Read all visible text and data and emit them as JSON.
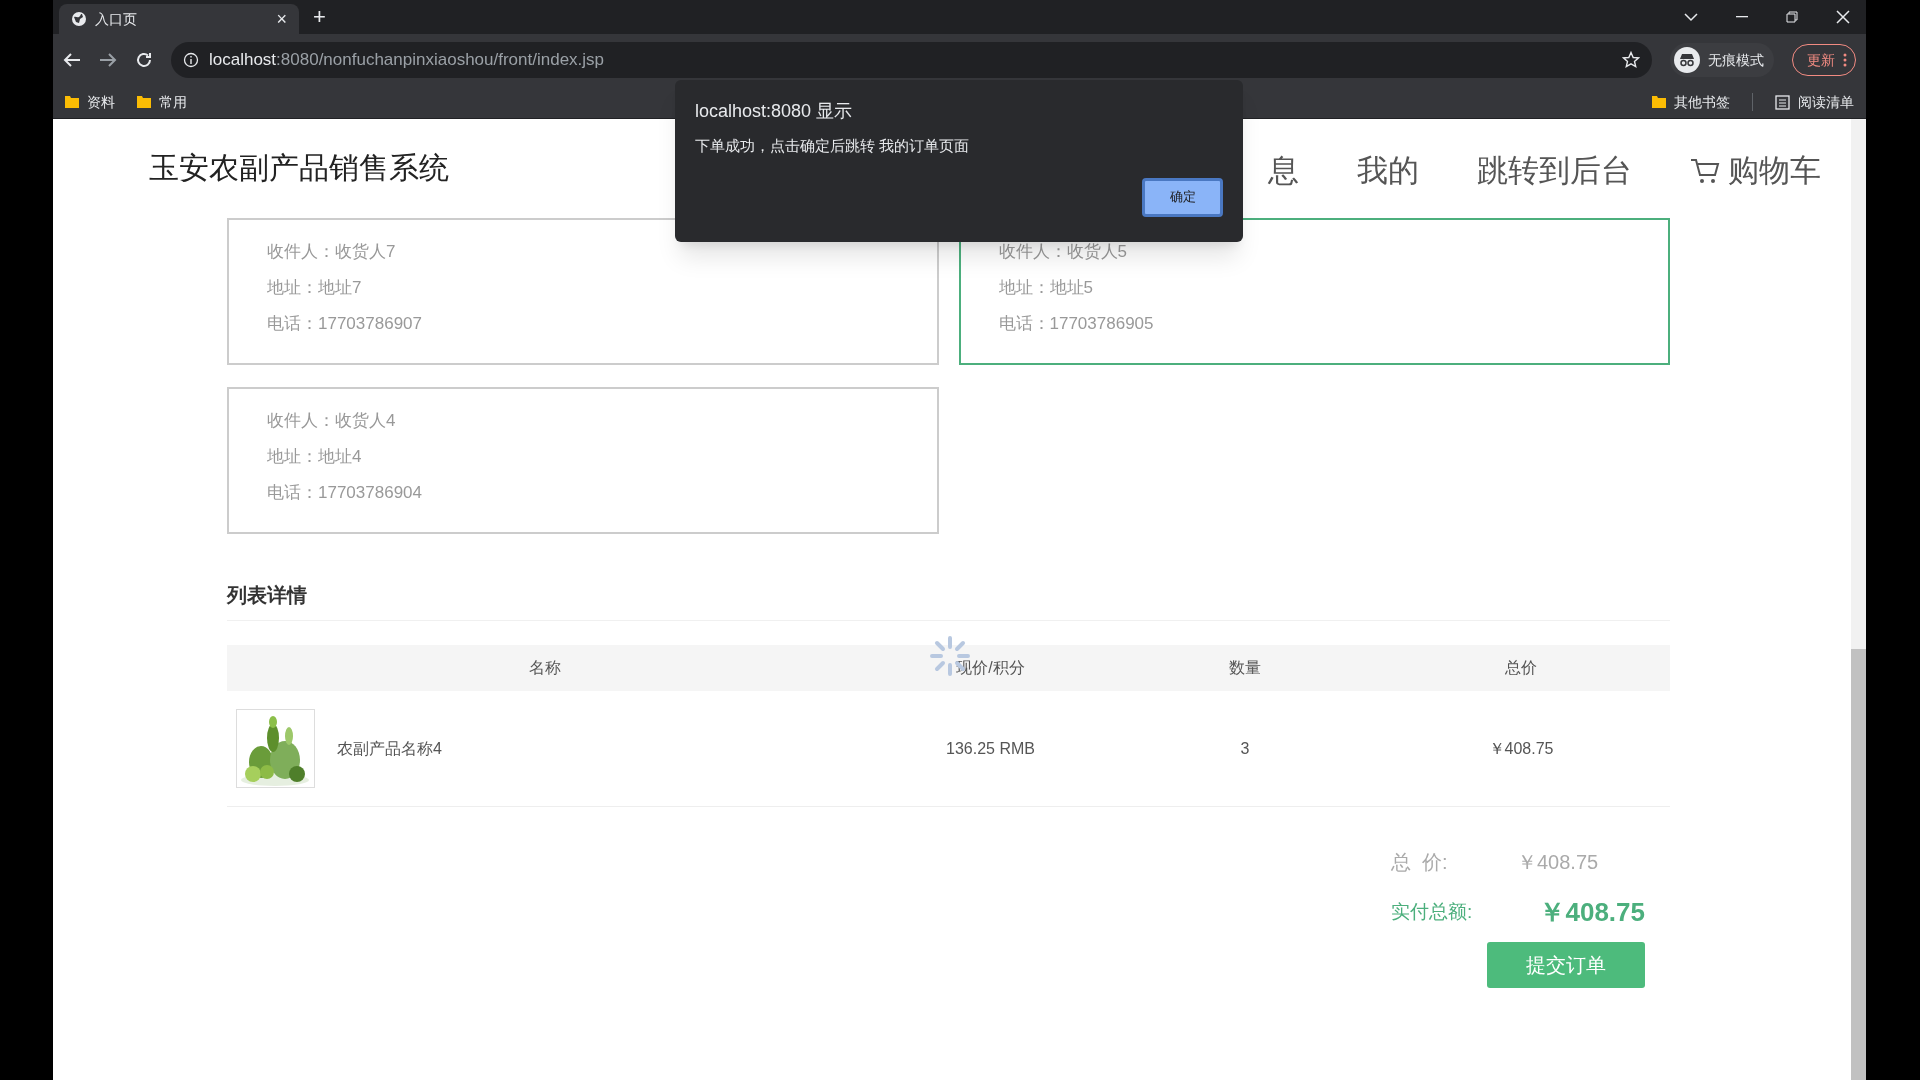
{
  "browser": {
    "tab": {
      "title": "入口页",
      "close": "×"
    },
    "new_tab": "+",
    "url": {
      "host": "localhost",
      "rest": ":8080/nonfuchanpinxiaoshou/front/index.jsp"
    },
    "profile": "无痕模式",
    "update": "更新",
    "bookmarks": [
      {
        "label": "资料"
      },
      {
        "label": "常用"
      }
    ],
    "bookmarks_right": [
      {
        "label": "其他书签",
        "kind": "folder"
      },
      {
        "label": "阅读清单",
        "kind": "list"
      }
    ]
  },
  "site": {
    "title": "玉安农副产品销售系统",
    "nav": [
      {
        "label": "息",
        "kind": "text"
      },
      {
        "label": "我的",
        "kind": "text"
      },
      {
        "label": "跳转到后台",
        "kind": "text"
      },
      {
        "label": "购物车",
        "kind": "cart"
      }
    ]
  },
  "addresses": [
    {
      "lines": [
        "收件人：收货人7",
        "地址：地址7",
        "电话：17703786907"
      ],
      "selected": false
    },
    {
      "lines": [
        "收件人：收货人5",
        "地址：地址5",
        "电话：17703786905"
      ],
      "selected": true
    },
    {
      "lines": [
        "收件人：收货人4",
        "地址：地址4",
        "电话：17703786904"
      ],
      "selected": false
    }
  ],
  "section_title": "列表详情",
  "table": {
    "columns": [
      "名称",
      "现价/积分",
      "数量",
      "总价"
    ],
    "loading": true,
    "rows": [
      {
        "cells": [
          "农副产品名称4",
          "136.25 RMB",
          "3",
          "￥408.75"
        ]
      }
    ]
  },
  "summary": {
    "total_label": "总  价:",
    "total": "￥408.75",
    "paid_label": "实付总额:",
    "paid": "￥408.75"
  },
  "submit": "提交订单",
  "dialog": {
    "title": "localhost:8080 显示",
    "message": "下单成功，点击确定后跳转 我的订单页面",
    "ok": "确定"
  }
}
